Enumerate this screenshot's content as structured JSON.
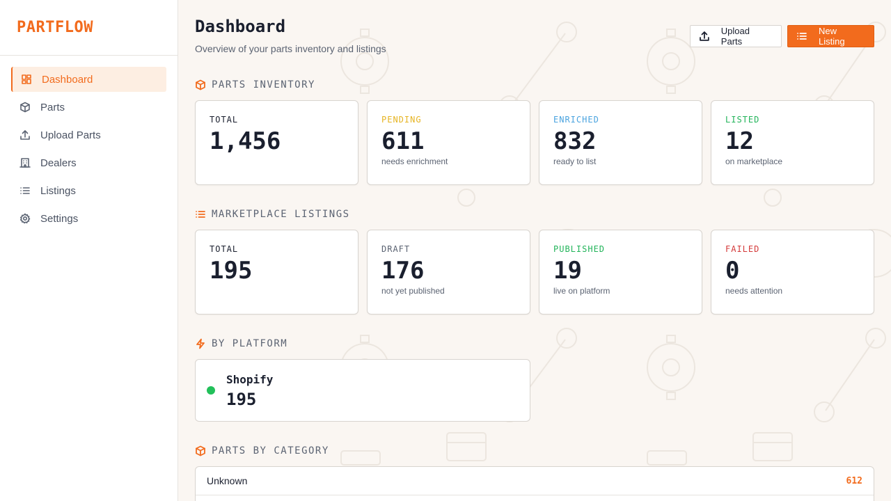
{
  "brand": {
    "name": "PARTFLOW",
    "color": "#f26b1d"
  },
  "sidebar": {
    "items": [
      {
        "label": "Dashboard",
        "icon": "dashboard-icon",
        "active": true
      },
      {
        "label": "Parts",
        "icon": "box-icon",
        "active": false
      },
      {
        "label": "Upload Parts",
        "icon": "upload-icon",
        "active": false
      },
      {
        "label": "Dealers",
        "icon": "building-icon",
        "active": false
      },
      {
        "label": "Listings",
        "icon": "list-icon",
        "active": false
      },
      {
        "label": "Settings",
        "icon": "gear-icon",
        "active": false
      }
    ]
  },
  "header": {
    "title": "Dashboard",
    "subtitle": "Overview of your parts inventory and listings",
    "upload_label": "Upload Parts",
    "new_listing_label": "New Listing"
  },
  "inventory": {
    "title": "PARTS INVENTORY",
    "cards": [
      {
        "label": "TOTAL",
        "value": "1,456",
        "sub": "",
        "color": "#1a1f2e"
      },
      {
        "label": "PENDING",
        "value": "611",
        "sub": "needs enrichment",
        "color": "#e6b422"
      },
      {
        "label": "ENRICHED",
        "value": "832",
        "sub": "ready to list",
        "color": "#4aa3df"
      },
      {
        "label": "LISTED",
        "value": "12",
        "sub": "on marketplace",
        "color": "#22b45a"
      }
    ]
  },
  "listings": {
    "title": "MARKETPLACE LISTINGS",
    "cards": [
      {
        "label": "TOTAL",
        "value": "195",
        "sub": "",
        "color": "#1a1f2e"
      },
      {
        "label": "DRAFT",
        "value": "176",
        "sub": "not yet published",
        "color": "#5b6372"
      },
      {
        "label": "PUBLISHED",
        "value": "19",
        "sub": "live on platform",
        "color": "#22b45a"
      },
      {
        "label": "FAILED",
        "value": "0",
        "sub": "needs attention",
        "color": "#d43a3a"
      }
    ]
  },
  "platforms": {
    "title": "BY PLATFORM",
    "items": [
      {
        "name": "Shopify",
        "count": "195",
        "color": "#22c05a"
      }
    ]
  },
  "categories": {
    "title": "PARTS BY CATEGORY",
    "rows": [
      {
        "name": "Unknown",
        "count": "612"
      }
    ]
  }
}
